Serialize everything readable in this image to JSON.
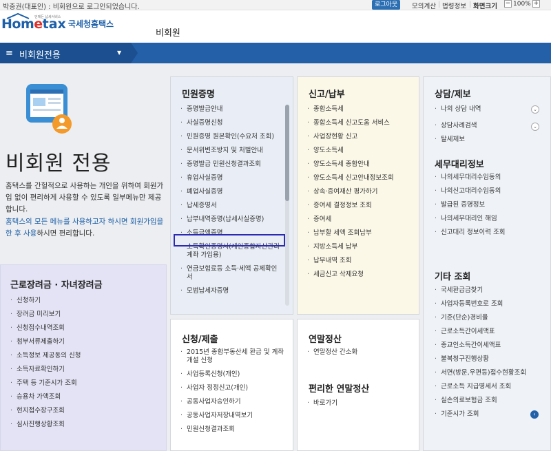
{
  "topbar": {
    "message": "박중권(대표인) : 비회원으로 로그인되었습니다.",
    "logout": "로그아웃",
    "utilities": [
      "모의계산",
      "법령정보",
      "화면크기"
    ],
    "zoom_minus": "−",
    "zoom_value": "100%",
    "zoom_plus": "+"
  },
  "header": {
    "logo_home": "Hom",
    "logo_e": "e",
    "logo_tax": "tax",
    "logo_tagline": "언제든 납세서비스",
    "logo_sub": "국세청홈택스",
    "member_label": "비회원"
  },
  "nav": {
    "title": "비회원전용",
    "dropdown": "▼"
  },
  "hero": {
    "title": "비회원 전용",
    "desc": "홈택스를 간헐적으로 사용하는 개인을 위하여 회원가입 없이 편리하게 사용할 수 있도록 일부메뉴만 제공합니다.",
    "link_blue": "홈택스의 모든 메뉴를 사용하고자 하시면 회원가입을 한 후 사용",
    "link_rest": "하시면 편리합니다."
  },
  "panels": {
    "work": {
      "title": "근로장려금 · 자녀장려금",
      "items": [
        "신청하기",
        "장려금 미리보기",
        "신청접수내역조회",
        "첨부서류제출하기",
        "소득정보 제공동의 신청",
        "소득자료확인하기",
        "주택 등 기준시가 조회",
        "승용차 가액조회",
        "현지접수장구조회",
        "심사진행상황조회"
      ]
    },
    "civil": {
      "title": "민원증명",
      "items": [
        "증명발급안내",
        "사실증명신청",
        "민원증명 원본확인(수요처 조회)",
        "문서위변조방지 및 처벌안내",
        "증명발급 민원신청결과조회",
        "휴업사실증명",
        "폐업사실증명",
        "납세증명서",
        "납부내역증명(납세사실증명)",
        "소득금액증명",
        "소득확인증명서(개인종합자산관리계좌 가입용)",
        "연금보험료등 소득·세액 공제확인서",
        "모범납세자증명"
      ]
    },
    "report": {
      "title": "신고/납부",
      "items": [
        "종합소득세",
        "종합소득세 신고도움 서비스",
        "사업장현황 신고",
        "양도소득세",
        "양도소득세 종합안내",
        "양도소득세 신고안내정보조회",
        "상속·증여재산 평가하기",
        "증여세 결정정보 조회",
        "증여세",
        "납부할 세액 조회납부",
        "지방소득세 납부",
        "납부내역 조회",
        "세금신고 삭제요청"
      ]
    },
    "consult": {
      "title": "상담/제보",
      "items": [
        "나의 상담 내역",
        "상담사례검색",
        "탈세제보"
      ],
      "agent_title": "세무대리정보",
      "agent_items": [
        "나의세무대리수임동의",
        "나의신고대리수임동의",
        "발급된 증명정보",
        "나의세무대리인 해임",
        "신고대리 정보이력 조회"
      ],
      "etc_title": "기타 조회",
      "etc_items": [
        "국세환급금찾기",
        "사업자등록번호로 조회",
        "기준(단순)경비율",
        "근로소득간이세액표",
        "종교인소득간이세액표",
        "불복청구진행상황",
        "서면(방문,우편등)접수현황조회",
        "근로소득 지급명세서 조회",
        "실손의료보험금 조회",
        "기준시가 조회"
      ]
    },
    "file": {
      "title": "신청/제출",
      "items": [
        "2015년 종합부동산세 환급 및 계좌개설 신청",
        "사업등록신청(개인)",
        "사업자 정정신고(개인)",
        "공동사업자승인하기",
        "공동사업자저장내역보기",
        "민원신청결과조회"
      ]
    },
    "year": {
      "title": "연말정산",
      "items": [
        "연말정산 간소화"
      ],
      "title2": "편리한 연말정산",
      "items2": [
        "바로가기"
      ]
    }
  },
  "icons": {
    "expand": "⌄",
    "nav_prev": "‹"
  },
  "colors": {
    "nav_blue": "#2360a8",
    "highlight": "#2a2ab5"
  }
}
